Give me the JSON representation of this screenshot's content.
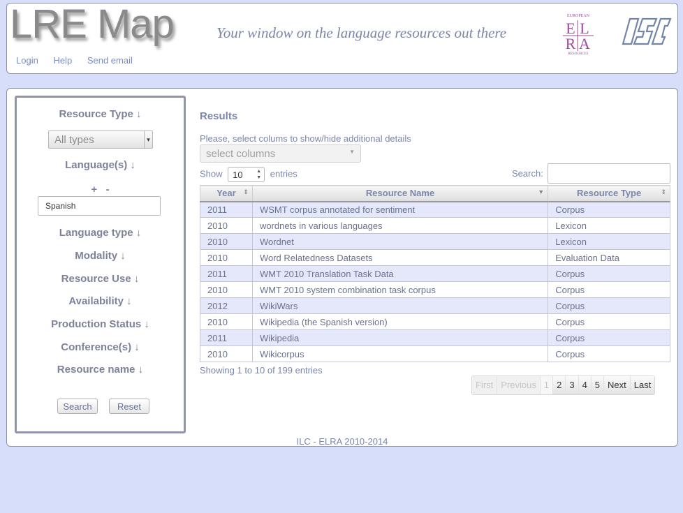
{
  "header": {
    "logo": "LRE Map",
    "tagline": "Your window on the language resources out there",
    "elra_logo": {
      "letters": "ELRA",
      "ring_text": "EUROPEAN LANGUAGE RESOURCES ASSOCIATION"
    },
    "nav": [
      "Login",
      "Help",
      "Send email"
    ]
  },
  "sidebar": {
    "resource_type": "Resource Type ↓",
    "type_select_value": "All types",
    "languages": "Language(s) ↓",
    "plus": "+",
    "minus": "-",
    "language_value": "Spanish",
    "language_type": "Language type ↓",
    "modality": "Modality ↓",
    "resource_use": "Resource Use ↓",
    "availability": "Availability ↓",
    "production_status": "Production Status ↓",
    "conferences": "Conference(s) ↓",
    "resource_name": "Resource name ↓",
    "search_button": "Search",
    "reset_button": "Reset"
  },
  "results": {
    "title": "Results",
    "columns_hint": "Please, select colums to show/hide additional details",
    "columns_select": "select columns",
    "show_label": "Show",
    "page_length": "10",
    "entries_label": "entries",
    "search_label": "Search:",
    "headers": [
      "Year",
      "Resource Name",
      "Resource Type"
    ],
    "rows": [
      [
        "2011",
        "WSMT corpus annotated for sentiment",
        "Corpus"
      ],
      [
        "2010",
        "wordnets in various languages",
        "Lexicon"
      ],
      [
        "2010",
        "Wordnet",
        "Lexicon"
      ],
      [
        "2010",
        "Word Relatedness Datasets",
        "Evaluation Data"
      ],
      [
        "2011",
        "WMT 2010 Translation Task Data",
        "Corpus"
      ],
      [
        "2010",
        "WMT 2010 system combination task corpus",
        "Corpus"
      ],
      [
        "2012",
        "WikiWars",
        "Corpus"
      ],
      [
        "2010",
        "Wikipedia (the Spanish version)",
        "Corpus"
      ],
      [
        "2011",
        "Wikipedia",
        "Corpus"
      ],
      [
        "2010",
        "Wikicorpus",
        "Corpus"
      ]
    ],
    "info": "Showing 1 to 10 of 199 entries",
    "pager": {
      "first": "First",
      "previous": "Previous",
      "pages": [
        "1",
        "2",
        "3",
        "4",
        "5"
      ],
      "next": "Next",
      "last": "Last"
    }
  },
  "footer": "ILC - ELRA 2010-2014",
  "colors": {
    "page_bg": "#d6defa",
    "row_odd": "#e5e8fb",
    "text": "#6a7290",
    "elra_purple": "#a04a9c",
    "ilc_blue": "#7486a8"
  }
}
